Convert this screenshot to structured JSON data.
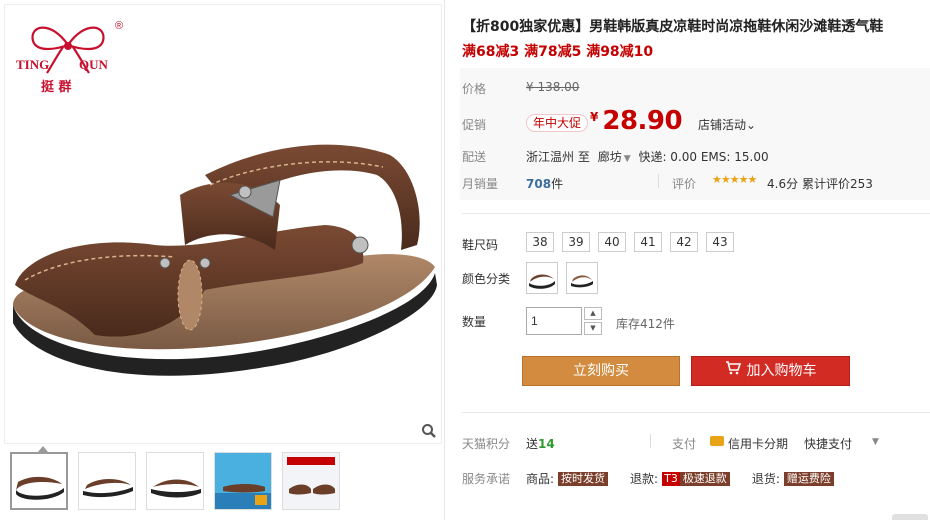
{
  "brand": {
    "name_en_1": "TING",
    "name_en_2": "QUN",
    "name_cn": "挺 群",
    "registered": "®"
  },
  "gallery": {
    "thumb_count": 5
  },
  "product": {
    "title": "【折800独家优惠】男鞋韩版真皮凉鞋时尚凉拖鞋休闲沙滩鞋透气鞋",
    "promo": "满68减3 满78减5 满98减10"
  },
  "price": {
    "label": "价格",
    "original": "¥ 138.00",
    "promo_label": "促销",
    "promo_tag": "年中大促",
    "currency": "¥",
    "current": "28.90",
    "store_activity": "店铺活动",
    "store_activity_caret": "⌄"
  },
  "shipping": {
    "label": "配送",
    "from": "浙江温州",
    "to_word": "至",
    "to": "廊坊",
    "caret": "▼",
    "fees": "快递: 0.00 EMS: 15.00"
  },
  "sales": {
    "label": "月销量",
    "count": "708",
    "unit": "件",
    "rating_label": "评价",
    "stars": "★★★★★",
    "rating": "4.6分",
    "review_count": "累计评价253"
  },
  "options": {
    "size_label": "鞋尺码",
    "sizes": [
      "38",
      "39",
      "40",
      "41",
      "42",
      "43"
    ],
    "color_label": "颜色分类",
    "color_count": 2,
    "qty_label": "数量",
    "qty_value": "1",
    "qty_up": "▲",
    "qty_down": "▼",
    "stock": "库存412件"
  },
  "buttons": {
    "buy": "立刻购买",
    "cart": "加入购物车"
  },
  "extras": {
    "points_label": "天猫积分",
    "points_prefix": "送",
    "points_value": "14",
    "pay_label": "支付",
    "card_pay": "信用卡分期",
    "quick_pay": "快捷支付",
    "quick_caret": "▼",
    "service_label": "服务承诺",
    "goods_label": "商品:",
    "goods_tag": "按时发货",
    "refund_label": "退款:",
    "refund_t3": "T3",
    "refund_tag": "极速退款",
    "return_label": "退货:",
    "return_tag": "赠运费险"
  },
  "colors": {
    "price_red": "#c40000",
    "buy_button": "#d28b3f",
    "cart_button": "#d22b24",
    "sales_blue": "#3c6e9b",
    "points_green": "#2c9a2c"
  },
  "icons": [
    "zoom-icon",
    "cart-icon",
    "credit-card-icon",
    "star-icon",
    "logo-bow-icon"
  ]
}
